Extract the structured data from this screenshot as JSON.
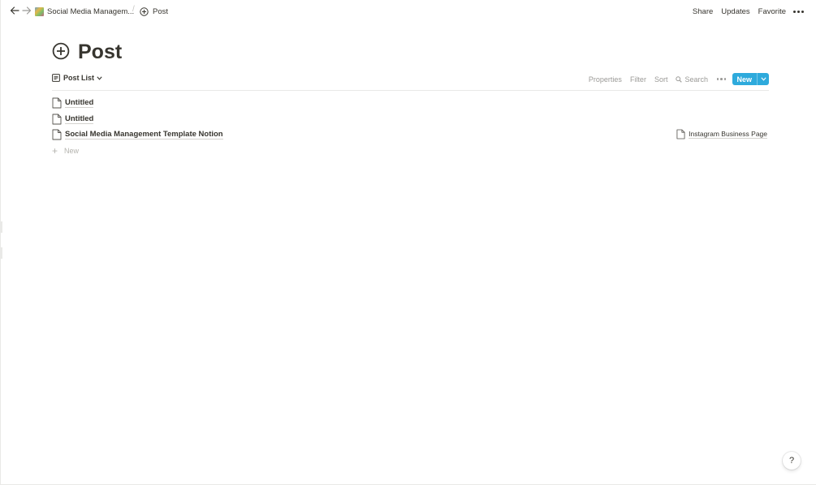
{
  "topbar": {
    "back_icon": "arrow-left-icon",
    "forward_icon": "arrow-right-icon",
    "breadcrumb": [
      {
        "label": "Social Media Managem...",
        "icon": "workspace-image-icon"
      },
      {
        "label": "Post",
        "icon": "circle-plus-icon"
      }
    ],
    "separator": "/",
    "share_label": "Share",
    "updates_label": "Updates",
    "favorite_label": "Favorite",
    "more_icon": "more-dots-icon"
  },
  "page": {
    "icon": "circle-plus-icon",
    "title": "Post"
  },
  "view": {
    "name": "Post List",
    "icon": "list-view-icon",
    "tools": {
      "properties": "Properties",
      "filter": "Filter",
      "sort": "Sort",
      "search": "Search",
      "more_icon": "more-dots-icon",
      "new_label": "New"
    }
  },
  "rows": [
    {
      "title": "Untitled",
      "relation": ""
    },
    {
      "title": "Untitled",
      "relation": ""
    },
    {
      "title": "Social Media Management Template Notion",
      "relation": "Instagram Business Page"
    }
  ],
  "add_row_label": "New",
  "help_label": "?",
  "colors": {
    "accent": "#2eaadc",
    "text": "#37352f",
    "muted": "#9b9a97",
    "divider": "#e9e9e7"
  }
}
